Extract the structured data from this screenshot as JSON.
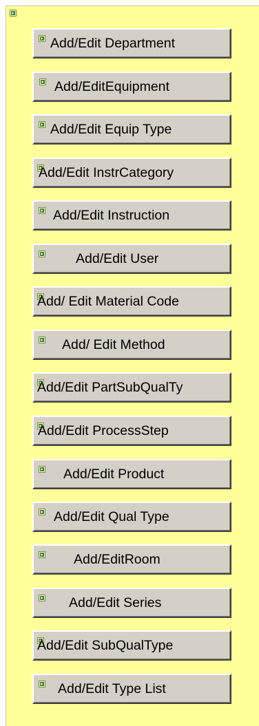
{
  "icons": {
    "default": "placeholder-image-icon",
    "color_border": "#7a8a20",
    "color_fill": "#2e7d1e"
  },
  "buttons": [
    {
      "label": "Add/Edit Department"
    },
    {
      "label": "Add/EditEquipment"
    },
    {
      "label": "Add/Edit Equip Type"
    },
    {
      "label": "Add/Edit InstrCategory"
    },
    {
      "label": "Add/Edit Instruction"
    },
    {
      "label": "Add/Edit User"
    },
    {
      "label": "Add/ Edit Material Code"
    },
    {
      "label": "Add/ Edit Method"
    },
    {
      "label": "Add/Edit PartSubQualTy"
    },
    {
      "label": "Add/Edit ProcessStep"
    },
    {
      "label": "Add/Edit Product"
    },
    {
      "label": "Add/Edit Qual Type"
    },
    {
      "label": "Add/EditRoom"
    },
    {
      "label": "Add/Edit Series"
    },
    {
      "label": "Add/Edit SubQualType"
    },
    {
      "label": "Add/Edit Type List"
    }
  ]
}
